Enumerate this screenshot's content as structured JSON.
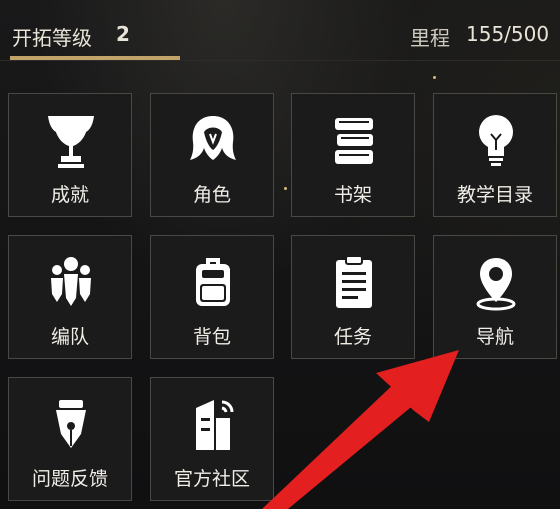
{
  "header": {
    "level_label": "开拓等级",
    "level_value": "2",
    "mileage_label": "里程",
    "mileage_value": "155/500"
  },
  "menu": {
    "items": [
      {
        "label": "成就",
        "icon": "trophy-icon"
      },
      {
        "label": "角色",
        "icon": "character-icon"
      },
      {
        "label": "书架",
        "icon": "bookshelf-icon"
      },
      {
        "label": "教学目录",
        "icon": "lightbulb-icon"
      },
      {
        "label": "编队",
        "icon": "team-icon"
      },
      {
        "label": "背包",
        "icon": "backpack-icon"
      },
      {
        "label": "任务",
        "icon": "task-icon"
      },
      {
        "label": "导航",
        "icon": "navigation-icon"
      },
      {
        "label": "问题反馈",
        "icon": "feedback-icon"
      },
      {
        "label": "官方社区",
        "icon": "community-icon"
      }
    ]
  },
  "colors": {
    "accent_gold": "#c2a36a",
    "arrow_red": "#e3201f",
    "tile_border": "#4a4843"
  }
}
